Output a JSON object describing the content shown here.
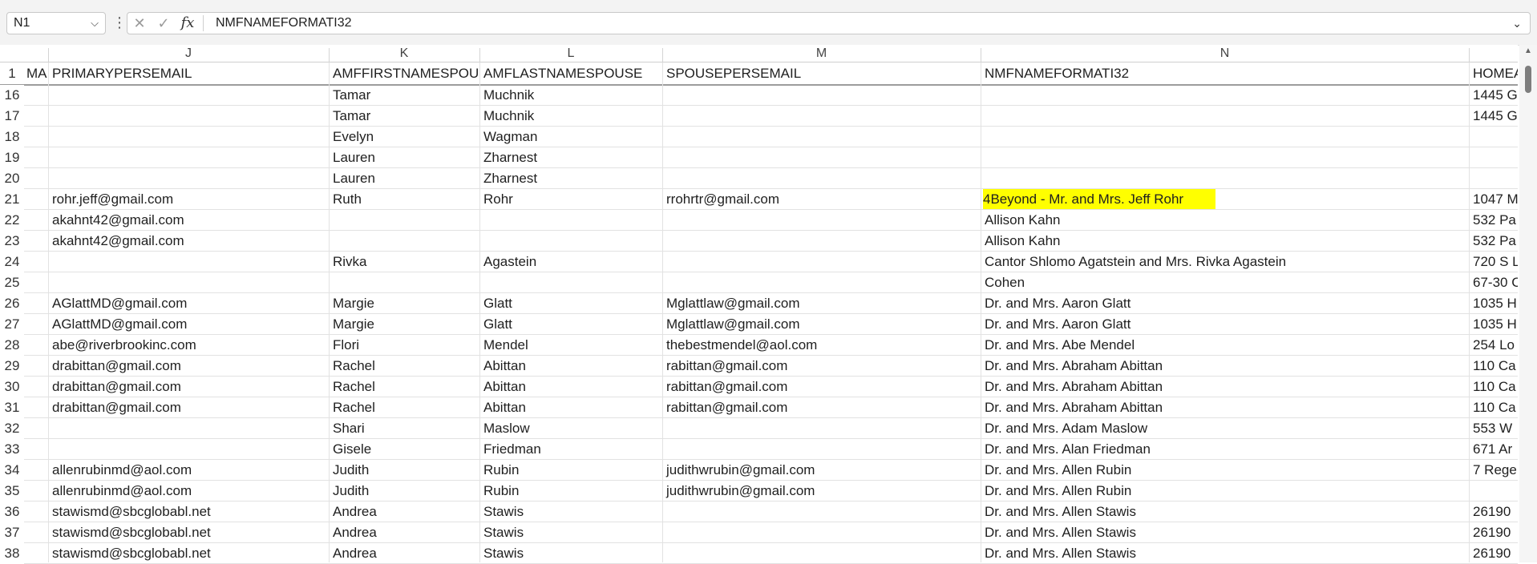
{
  "name_box": {
    "value": "N1",
    "dropdown_icon": "chevron-down-icon"
  },
  "formula_bar": {
    "more_icon": "vertical-ellipsis-icon",
    "cancel_icon": "x-icon",
    "enter_icon": "check-icon",
    "fx_label": "fx",
    "content": "NMFNAMEFORMATI32",
    "expand_icon": "chevron-down-icon"
  },
  "column_letters": [
    "",
    "J",
    "K",
    "L",
    "M",
    "N",
    ""
  ],
  "header_row": {
    "row_number": "1",
    "cells": [
      "MA",
      "PRIMARYPERSEMAIL",
      "AMFFIRSTNAMESPOUSE",
      "AMFLASTNAMESPOUSE",
      "SPOUSEPERSEMAIL",
      "NMFNAMEFORMATI32",
      "HOMEADDRESS"
    ]
  },
  "highlight_color": "#ffff00",
  "rows": [
    {
      "n": "16",
      "c": [
        "",
        "",
        "Tamar",
        "Muchnik",
        "",
        "",
        "1445 G"
      ]
    },
    {
      "n": "17",
      "c": [
        "",
        "",
        "Tamar",
        "Muchnik",
        "",
        "",
        "1445 G"
      ]
    },
    {
      "n": "18",
      "c": [
        "",
        "",
        "Evelyn",
        "Wagman",
        "",
        "",
        ""
      ]
    },
    {
      "n": "19",
      "c": [
        "",
        "",
        "Lauren",
        "Zharnest",
        "",
        "",
        ""
      ]
    },
    {
      "n": "20",
      "c": [
        "",
        "",
        "Lauren",
        "Zharnest",
        "",
        "",
        ""
      ]
    },
    {
      "n": "21",
      "c": [
        "",
        "rohr.jeff@gmail.com",
        "Ruth",
        "Rohr",
        "rrohrtr@gmail.com",
        "4Beyond - Mr. and Mrs. Jeff Rohr",
        "1047 M"
      ]
    },
    {
      "n": "22",
      "c": [
        "",
        "akahnt42@gmail.com",
        "",
        "",
        "",
        "Allison Kahn",
        "532 Pa"
      ]
    },
    {
      "n": "23",
      "c": [
        "",
        "akahnt42@gmail.com",
        "",
        "",
        "",
        "Allison Kahn",
        "532 Pa"
      ]
    },
    {
      "n": "24",
      "c": [
        "",
        "",
        "Rivka",
        "Agastein",
        "",
        "Cantor Shlomo Agatstein and Mrs. Rivka Agastein",
        "720 S L"
      ]
    },
    {
      "n": "25",
      "c": [
        "",
        "",
        "",
        "",
        "",
        "Cohen",
        "67-30 C"
      ]
    },
    {
      "n": "26",
      "c": [
        "",
        "AGlattMD@gmail.com",
        "Margie",
        "Glatt",
        "Mglattlaw@gmail.com",
        "Dr. and Mrs. Aaron Glatt",
        "1035 H"
      ]
    },
    {
      "n": "27",
      "c": [
        "",
        "AGlattMD@gmail.com",
        "Margie",
        "Glatt",
        "Mglattlaw@gmail.com",
        "Dr. and Mrs. Aaron Glatt",
        "1035 H"
      ]
    },
    {
      "n": "28",
      "c": [
        "",
        "abe@riverbrookinc.com",
        "Flori",
        "Mendel",
        "thebestmendel@aol.com",
        "Dr. and Mrs. Abe Mendel",
        "254 Lo"
      ]
    },
    {
      "n": "29",
      "c": [
        "",
        "drabittan@gmail.com",
        "Rachel",
        "Abittan",
        "rabittan@gmail.com",
        "Dr. and Mrs. Abraham Abittan",
        "110 Ca"
      ]
    },
    {
      "n": "30",
      "c": [
        "",
        "drabittan@gmail.com",
        "Rachel",
        "Abittan",
        "rabittan@gmail.com",
        "Dr. and Mrs. Abraham Abittan",
        "110 Ca"
      ]
    },
    {
      "n": "31",
      "c": [
        "",
        "drabittan@gmail.com",
        "Rachel",
        "Abittan",
        "rabittan@gmail.com",
        "Dr. and Mrs. Abraham Abittan",
        "110 Ca"
      ]
    },
    {
      "n": "32",
      "c": [
        "",
        "",
        "Shari",
        "Maslow",
        "",
        "Dr. and Mrs. Adam Maslow",
        "553 W"
      ]
    },
    {
      "n": "33",
      "c": [
        "",
        "",
        "Gisele",
        "Friedman",
        "",
        "Dr. and Mrs. Alan Friedman",
        "671 Ar"
      ]
    },
    {
      "n": "34",
      "c": [
        "",
        "allenrubinmd@aol.com",
        "Judith",
        "Rubin",
        "judithwrubin@gmail.com",
        "Dr. and Mrs. Allen Rubin",
        "7 Rege"
      ]
    },
    {
      "n": "35",
      "c": [
        "",
        "allenrubinmd@aol.com",
        "Judith",
        "Rubin",
        "judithwrubin@gmail.com",
        "Dr. and Mrs. Allen Rubin",
        ""
      ]
    },
    {
      "n": "36",
      "c": [
        "",
        "stawismd@sbcglobabl.net",
        "Andrea",
        "Stawis",
        "",
        "Dr. and Mrs. Allen Stawis",
        "26190"
      ]
    },
    {
      "n": "37",
      "c": [
        "",
        "stawismd@sbcglobabl.net",
        "Andrea",
        "Stawis",
        "",
        "Dr. and Mrs. Allen Stawis",
        "26190"
      ]
    },
    {
      "n": "38",
      "c": [
        "",
        "stawismd@sbcglobabl.net",
        "Andrea",
        "Stawis",
        "",
        "Dr. and Mrs. Allen Stawis",
        "26190"
      ]
    }
  ]
}
